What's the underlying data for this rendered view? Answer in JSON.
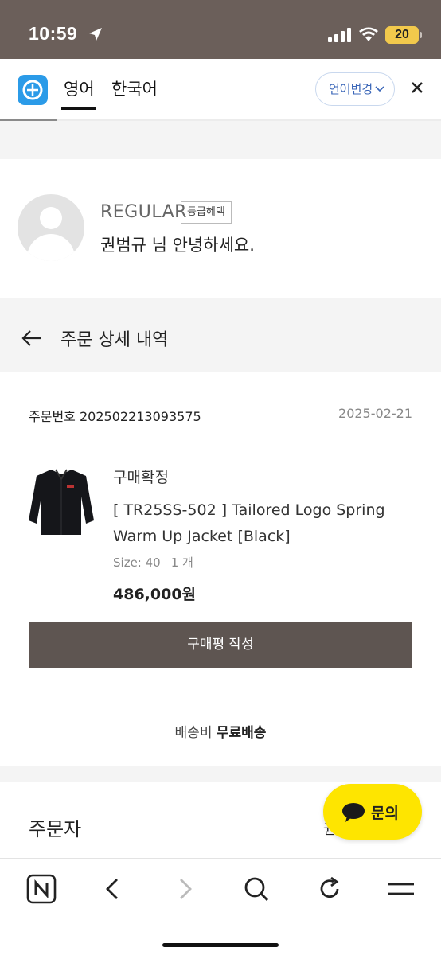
{
  "status_bar": {
    "time": "10:59",
    "battery": "20"
  },
  "translate_bar": {
    "tabs": [
      "영어",
      "한국어"
    ],
    "selected_tab": "영어",
    "language_button": "언어변경"
  },
  "member": {
    "grade": "REGULAR",
    "grade_badge": "등급혜택",
    "greeting": "권범규 님 안녕하세요."
  },
  "page": {
    "title": "주문 상세 내역"
  },
  "order": {
    "number_label": "주문번호",
    "number": "202502213093575",
    "date": "2025-02-21",
    "status": "구매확정",
    "product_name": "[ TR25SS-502 ] Tailored Logo Spring Warm Up Jacket [Black]",
    "size": "Size: 40",
    "quantity": "1 개",
    "price": "486,000원",
    "review_button": "구매평 작성",
    "shipping_label": "배송비",
    "shipping_value": "무료배송"
  },
  "orderer": {
    "label": "주문자",
    "value_cut": "권"
  },
  "inquiry_button": "문의",
  "colors": {
    "status_bar": "#6b5f5a",
    "review_button": "#5e5551",
    "inquiry": "#fee500",
    "link": "#3a66b8"
  }
}
